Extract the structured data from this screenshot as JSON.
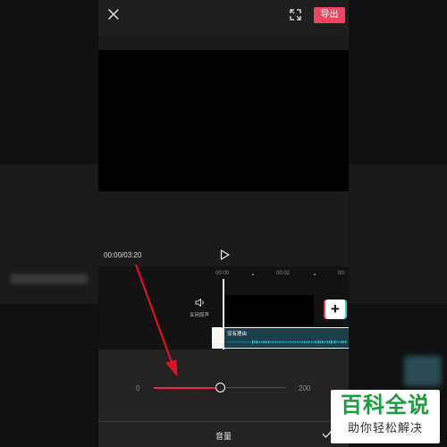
{
  "topbar": {
    "close_icon": "close-icon",
    "fullscreen_icon": "fullscreen-icon",
    "export_label": "导出"
  },
  "player": {
    "timecode": "00:00/03:20",
    "play_icon": "play-icon"
  },
  "timeline": {
    "ruler_labels": [
      "00:00",
      "00:02",
      "00:"
    ],
    "mute_icon": "speaker-icon",
    "mute_label": "关闭原声",
    "audio_track_title": "没有理由",
    "add_clip_label": "+"
  },
  "volume_panel": {
    "min_label": "0",
    "max_label": "200",
    "value_fraction": 0.5,
    "title": "音量",
    "confirm_icon": "check-icon"
  },
  "watermark": {
    "title": "百科全说",
    "subtitle": "助你轻松解决"
  },
  "colors": {
    "accent": "#f0435f",
    "slider_fill": "#e8264a",
    "annotation_arrow": "#e0102a",
    "audio_clip": "#1d3f4a",
    "waveform": "#3cc7d6",
    "watermark_green": "#1a9d3c"
  }
}
